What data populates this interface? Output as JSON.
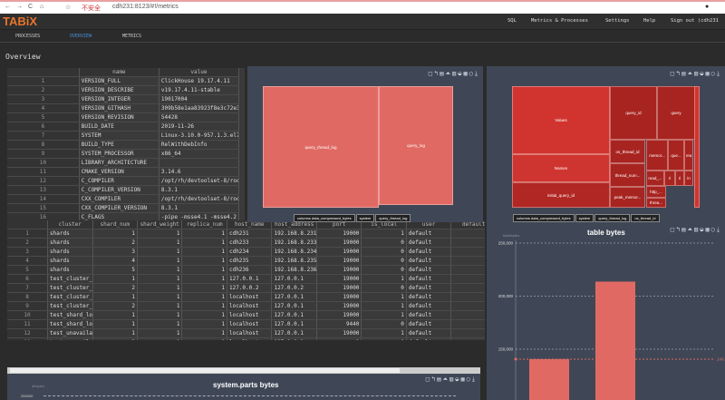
{
  "browser": {
    "security": "不安全",
    "url": "cdh231:8123/#!/metrics"
  },
  "app": {
    "logo": "TABiX",
    "nav": [
      "SQL",
      "Metrics & Processes",
      "Settings",
      "Help",
      "Sign out (cdh231"
    ]
  },
  "tabs": [
    {
      "label": "PROCESSES"
    },
    {
      "label": "OVERVIEW",
      "active": true
    },
    {
      "label": "METRICS"
    }
  ],
  "page_title": "Overview",
  "build_table": {
    "columns": [
      "name",
      "value"
    ],
    "rows": [
      [
        "VERSION_FULL",
        "ClickHouse 19.17.4.11"
      ],
      [
        "VERSION_DESCRIBE",
        "v19.17.4.11-stable"
      ],
      [
        "VERSION_INTEGER",
        "19017004"
      ],
      [
        "VERSION_GITHASH",
        "309b58e1aa83923f8e3c72e34342"
      ],
      [
        "VERSION_REVISION",
        "54428"
      ],
      [
        "BUILD_DATE",
        "2019-11-26"
      ],
      [
        "SYSTEM",
        "Linux-3.10.0-957.1.3.el7.x86_"
      ],
      [
        "BUILD_TYPE",
        "RelWithDebInfo"
      ],
      [
        "SYSTEM_PROCESSOR",
        "x86_64"
      ],
      [
        "LIBRARY_ARCHITECTURE",
        ""
      ],
      [
        "CMAKE_VERSION",
        "3.14.6"
      ],
      [
        "C_COMPILER",
        "/opt/rh/devtoolset-8/root/us"
      ],
      [
        "C_COMPILER_VERSION",
        "8.3.1"
      ],
      [
        "CXX_COMPILER",
        "/opt/rh/devtoolset-8/root/us"
      ],
      [
        "CXX_COMPILER_VERSION",
        "8.3.1"
      ],
      [
        "C_FLAGS",
        "-pipe -msse4.1 -msse4.2 -mpo"
      ],
      [
        "CXX_FLAGS",
        "-fsized-deallocation -pipe -"
      ]
    ]
  },
  "clusters_table": {
    "columns": [
      "cluster",
      "shard_num",
      "shard_weight",
      "replica_num",
      "host_name",
      "host_address",
      "port",
      "is_local",
      "user",
      "default"
    ],
    "rows": [
      [
        "shards",
        "1",
        "1",
        "1",
        "cdh231",
        "192.168.8.231",
        "19000",
        "1",
        "default",
        ""
      ],
      [
        "shards",
        "2",
        "1",
        "1",
        "cdh233",
        "192.168.8.233",
        "19000",
        "0",
        "default",
        ""
      ],
      [
        "shards",
        "3",
        "1",
        "1",
        "cdh234",
        "192.168.8.234",
        "19000",
        "0",
        "default",
        ""
      ],
      [
        "shards",
        "4",
        "1",
        "1",
        "cdh235",
        "192.168.8.235",
        "19000",
        "0",
        "default",
        ""
      ],
      [
        "shards",
        "5",
        "1",
        "1",
        "cdh236",
        "192.168.8.236",
        "19000",
        "0",
        "default",
        ""
      ],
      [
        "test_cluster_two_s",
        "1",
        "1",
        "1",
        "127.0.0.1",
        "127.0.0.1",
        "19000",
        "1",
        "default",
        ""
      ],
      [
        "test_cluster_two_s",
        "2",
        "1",
        "1",
        "127.0.0.2",
        "127.0.0.2",
        "19000",
        "0",
        "default",
        ""
      ],
      [
        "test_cluster_two_s",
        "1",
        "1",
        "1",
        "localhost",
        "127.0.0.1",
        "19000",
        "1",
        "default",
        ""
      ],
      [
        "test_cluster_two_s",
        "2",
        "1",
        "1",
        "localhost",
        "127.0.0.1",
        "19000",
        "1",
        "default",
        ""
      ],
      [
        "test_shard_localho",
        "1",
        "1",
        "1",
        "localhost",
        "127.0.0.1",
        "19000",
        "1",
        "default",
        ""
      ],
      [
        "test_shard_localho",
        "1",
        "1",
        "1",
        "localhost",
        "127.0.0.1",
        "9440",
        "0",
        "default",
        ""
      ],
      [
        "test_unavailable_s",
        "1",
        "1",
        "1",
        "localhost",
        "127.0.0.1",
        "19000",
        "1",
        "default",
        ""
      ],
      [
        "test_unavailable_s",
        "2",
        "1",
        "1",
        "localhost",
        "127.0.0.1",
        "1",
        "0",
        "default",
        ""
      ]
    ]
  },
  "treemap1": {
    "cells": [
      "query_thread_log",
      "query_log"
    ],
    "breadcrumb": [
      "columns data_compressed_bytes",
      "system",
      "query_thread_log"
    ]
  },
  "treemap2": {
    "cells": [
      "Values",
      "Names",
      "initial_query_id",
      "query_id",
      "query",
      "os_thread_id",
      "memor...",
      "que...",
      "rea",
      "thread_num...",
      "read_...",
      "ri",
      "ri",
      "in",
      "peak_memor...",
      "http_...",
      "threa..."
    ],
    "breadcrumb": [
      "columns data_compressed_bytes",
      "system",
      "query_thread_log",
      "os_thread_id"
    ]
  },
  "toolbar_icons": [
    "zoom-icon",
    "zoom-reset-icon",
    "data-view-icon",
    "line-icon",
    "bar-icon",
    "stack-icon",
    "tiled-icon",
    "restore-icon",
    "download-icon"
  ],
  "colors": {
    "accent": "#e8742c",
    "bar": "#e06a63",
    "treemap2": "#c23531",
    "panel": "#3f4756"
  },
  "chart_data": [
    {
      "type": "bar",
      "title": "table bytes",
      "ylabel": "tablebytes",
      "yticks": [
        150000,
        200000,
        250000
      ],
      "values": [
        140600,
        213700
      ],
      "markline": {
        "value": 140600,
        "label": "140..."
      },
      "grid": true
    },
    {
      "type": "bar",
      "title": "system.parts bytes",
      "ylabel": "dbbytes",
      "yticks": [
        250000
      ]
    }
  ]
}
